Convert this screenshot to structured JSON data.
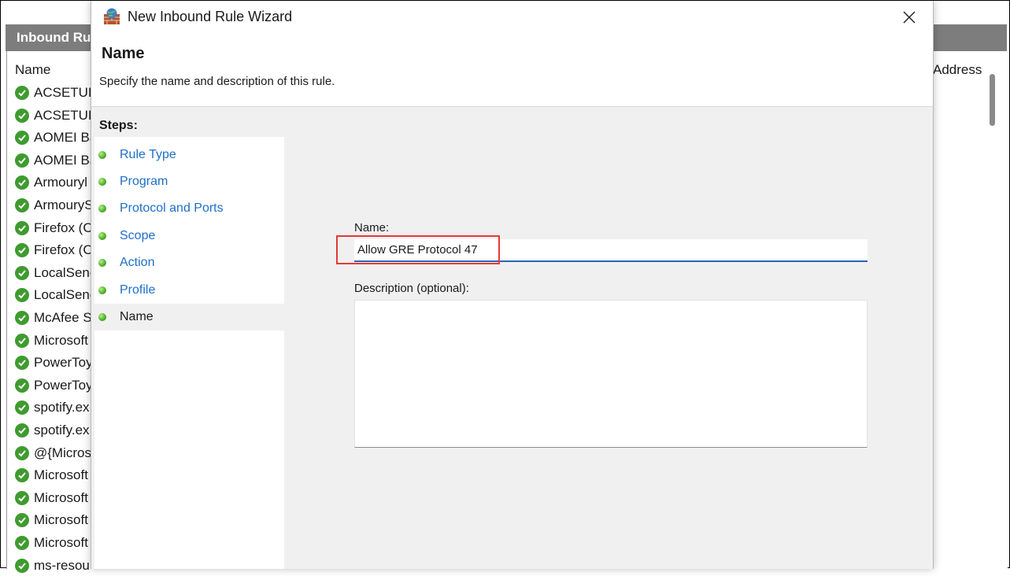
{
  "background_window": {
    "panel_title": "Inbound Ru",
    "columns": {
      "name": "Name",
      "address": "Address"
    },
    "rules": [
      "ACSETUP",
      "ACSETUP",
      "AOMEI Ba",
      "AOMEI Ba",
      "Armouryl",
      "ArmouryS",
      "Firefox (C",
      "Firefox (C",
      "LocalSenc",
      "LocalSenc",
      "McAfee S",
      "Microsoft",
      "PowerToy",
      "PowerToy",
      "spotify.ex",
      "spotify.ex",
      "@{Micros",
      "Microsoft",
      "Microsoft",
      "Microsoft",
      "Microsoft",
      "ms-resou"
    ]
  },
  "wizard": {
    "window_title": "New Inbound Rule Wizard",
    "heading": "Name",
    "subheading": "Specify the name and description of this rule.",
    "steps_title": "Steps:",
    "steps": [
      {
        "label": "Rule Type",
        "current": false
      },
      {
        "label": "Program",
        "current": false
      },
      {
        "label": "Protocol and Ports",
        "current": false
      },
      {
        "label": "Scope",
        "current": false
      },
      {
        "label": "Action",
        "current": false
      },
      {
        "label": "Profile",
        "current": false
      },
      {
        "label": "Name",
        "current": true
      }
    ],
    "name_label": "Name:",
    "name_value": "Allow GRE Protocol 47",
    "description_label": "Description (optional):",
    "description_value": ""
  },
  "icons": {
    "app": "firewall-wizard-icon",
    "close": "close-icon",
    "rule_enabled": "check-circle-icon",
    "step_bullet": "green-dot-icon"
  },
  "colors": {
    "link": "#1d6fc8",
    "highlight": "#e53935",
    "check": "#3f9b2f",
    "input_underline": "#2a63b8"
  }
}
